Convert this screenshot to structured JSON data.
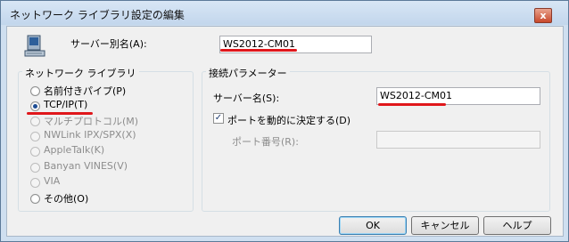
{
  "window": {
    "title": "ネットワーク ライブラリ設定の編集",
    "close_label": "x"
  },
  "alias": {
    "label": "サーバー別名(A):",
    "value": "WS2012-CM01"
  },
  "network_library": {
    "group_label": "ネットワーク ライブラリ",
    "options": [
      {
        "label": "名前付きパイプ(P)"
      },
      {
        "label": "TCP/IP(T)"
      },
      {
        "label": "マルチプロトコル(M)"
      },
      {
        "label": "NWLink IPX/SPX(X)"
      },
      {
        "label": "AppleTalk(K)"
      },
      {
        "label": "Banyan VINES(V)"
      },
      {
        "label": "VIA"
      },
      {
        "label": "その他(O)"
      }
    ],
    "selected": "TCP/IP(T)"
  },
  "connection": {
    "group_label": "接続パラメーター",
    "server_label": "サーバー名(S):",
    "server_value": "WS2012-CM01",
    "dynamic_port_label": "ポートを動的に決定する(D)",
    "dynamic_port_checked": true,
    "port_label": "ポート番号(R):",
    "port_value": ""
  },
  "buttons": {
    "ok": "OK",
    "cancel": "キャンセル",
    "help": "ヘルプ"
  },
  "colors": {
    "annotation_red": "#e0171b",
    "title_bar": "#cfdff0"
  }
}
